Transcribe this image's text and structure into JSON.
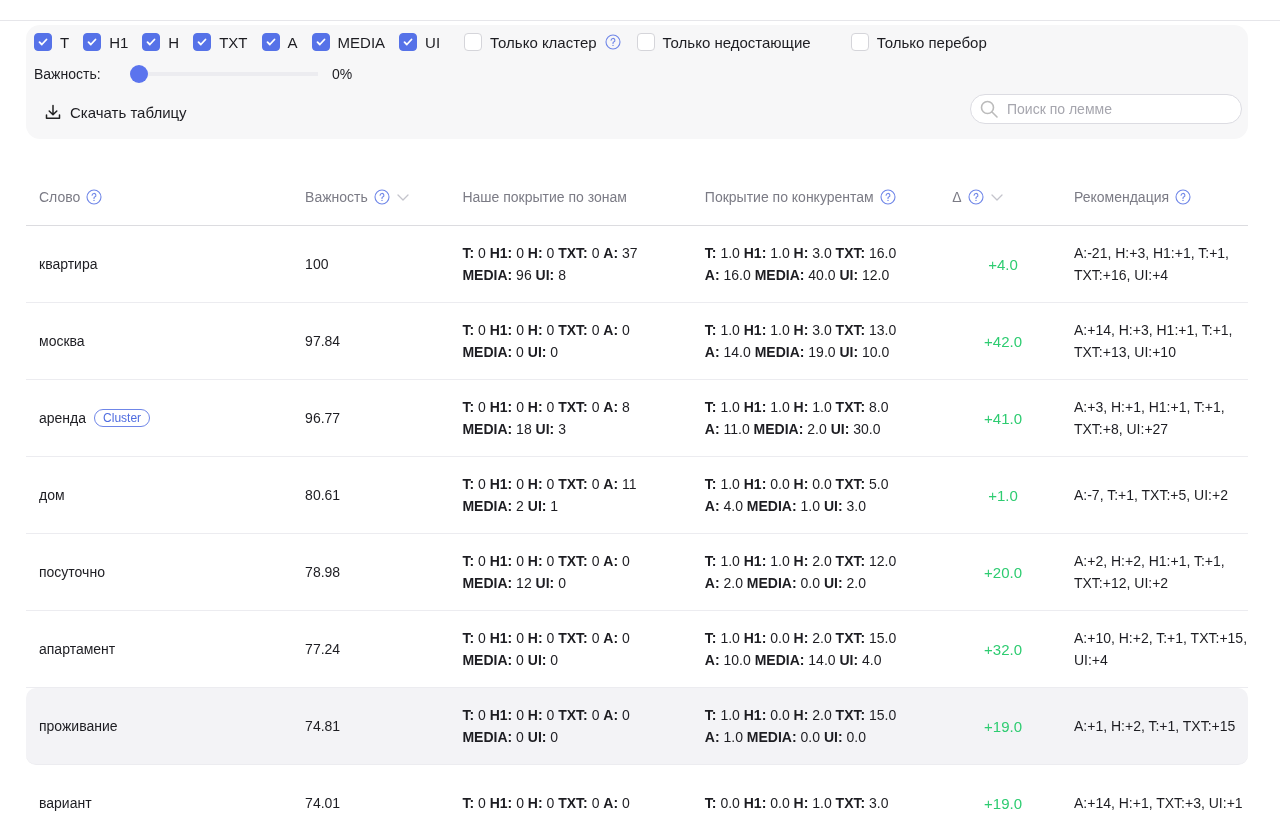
{
  "filters": [
    {
      "label": "T",
      "checked": true
    },
    {
      "label": "H1",
      "checked": true
    },
    {
      "label": "H",
      "checked": true
    },
    {
      "label": "TXT",
      "checked": true
    },
    {
      "label": "A",
      "checked": true
    },
    {
      "label": "MEDIA",
      "checked": true
    },
    {
      "label": "UI",
      "checked": true
    }
  ],
  "toggles": [
    {
      "label": "Только кластер",
      "checked": false,
      "help": true
    },
    {
      "label": "Только недостающие",
      "checked": false,
      "help": false
    },
    {
      "label": "Только перебор",
      "checked": false,
      "help": false
    }
  ],
  "importance": {
    "label": "Важность:",
    "level": 0,
    "reading": "0%"
  },
  "download": {
    "label": "Скачать таблицу"
  },
  "search": {
    "placeholder": "Поиск по лемме"
  },
  "table": {
    "columns": [
      {
        "label": "Слово",
        "help": true,
        "sortable": false
      },
      {
        "label": "Важность",
        "help": true,
        "sortable": true
      },
      {
        "label": "Наше покрытие по зонам",
        "help": false,
        "sortable": false
      },
      {
        "label": "Покрытие по конкурентам",
        "help": true,
        "sortable": false
      },
      {
        "label": "Δ",
        "help": true,
        "sortable": true
      },
      {
        "label": "Рекомендация",
        "help": true,
        "sortable": false
      }
    ],
    "rows": [
      {
        "word": "квартира",
        "tag": null,
        "importance": "100",
        "ours": [
          "**T:** 0 **H1:** 0 **H:** 0 **TXT:** 0 **A:** 37",
          "**MEDIA:** 96 **UI:** 8"
        ],
        "comp": [
          "**T:** 1.0 **H1:** 1.0 **H:** 3.0 **TXT:** 16.0",
          "**A:** 16.0 **MEDIA:** 40.0 **UI:** 12.0"
        ],
        "delta": "+4.0",
        "rec": "A:-21, H:+3, H1:+1, T:+1, TXT:+16, UI:+4",
        "selected": false
      },
      {
        "word": "москва",
        "tag": null,
        "importance": "97.84",
        "ours": [
          "**T:** 0 **H1:** 0 **H:** 0 **TXT:** 0 **A:** 0",
          "**MEDIA:** 0 **UI:** 0"
        ],
        "comp": [
          "**T:** 1.0 **H1:** 1.0 **H:** 3.0 **TXT:** 13.0",
          "**A:** 14.0 **MEDIA:** 19.0 **UI:** 10.0"
        ],
        "delta": "+42.0",
        "rec": "A:+14, H:+3, H1:+1, T:+1, TXT:+13, UI:+10",
        "selected": false
      },
      {
        "word": "аренда",
        "tag": "Cluster",
        "importance": "96.77",
        "ours": [
          "**T:** 0 **H1:** 0 **H:** 0 **TXT:** 0 **A:** 8",
          "**MEDIA:** 18 **UI:** 3"
        ],
        "comp": [
          "**T:** 1.0 **H1:** 1.0 **H:** 1.0 **TXT:** 8.0",
          "**A:** 11.0 **MEDIA:** 2.0 **UI:** 30.0"
        ],
        "delta": "+41.0",
        "rec": "A:+3, H:+1, H1:+1, T:+1, TXT:+8, UI:+27",
        "selected": false
      },
      {
        "word": "дом",
        "tag": null,
        "importance": "80.61",
        "ours": [
          "**T:** 0 **H1:** 0 **H:** 0 **TXT:** 0 **A:** 11",
          "**MEDIA:** 2 **UI:** 1"
        ],
        "comp": [
          "**T:** 1.0 **H1:** 0.0 **H:** 0.0 **TXT:** 5.0",
          "**A:** 4.0 **MEDIA:** 1.0 **UI:** 3.0"
        ],
        "delta": "+1.0",
        "rec": "A:-7, T:+1, TXT:+5, UI:+2",
        "selected": false
      },
      {
        "word": "посуточно",
        "tag": null,
        "importance": "78.98",
        "ours": [
          "**T:** 0 **H1:** 0 **H:** 0 **TXT:** 0 **A:** 0",
          "**MEDIA:** 12 **UI:** 0"
        ],
        "comp": [
          "**T:** 1.0 **H1:** 1.0 **H:** 2.0 **TXT:** 12.0",
          "**A:** 2.0 **MEDIA:** 0.0 **UI:** 2.0"
        ],
        "delta": "+20.0",
        "rec": "A:+2, H:+2, H1:+1, T:+1, TXT:+12, UI:+2",
        "selected": false
      },
      {
        "word": "апартамент",
        "tag": null,
        "importance": "77.24",
        "ours": [
          "**T:** 0 **H1:** 0 **H:** 0 **TXT:** 0 **A:** 0",
          "**MEDIA:** 0 **UI:** 0"
        ],
        "comp": [
          "**T:** 1.0 **H1:** 0.0 **H:** 2.0 **TXT:** 15.0",
          "**A:** 10.0 **MEDIA:** 14.0 **UI:** 4.0"
        ],
        "delta": "+32.0",
        "rec": "A:+10, H:+2, T:+1, TXT:+15, UI:+4",
        "selected": false
      },
      {
        "word": "проживание",
        "tag": null,
        "importance": "74.81",
        "ours": [
          "**T:** 0 **H1:** 0 **H:** 0 **TXT:** 0 **A:** 0",
          "**MEDIA:** 0 **UI:** 0"
        ],
        "comp": [
          "**T:** 1.0 **H1:** 0.0 **H:** 2.0 **TXT:** 15.0",
          "**A:** 1.0 **MEDIA:** 0.0 **UI:** 0.0"
        ],
        "delta": "+19.0",
        "rec": "A:+1, H:+2, T:+1, TXT:+15",
        "selected": true
      },
      {
        "word": "вариант",
        "tag": null,
        "importance": "74.01",
        "ours": [
          "**T:** 0 **H1:** 0 **H:** 0 **TXT:** 0 **A:** 0"
        ],
        "comp": [
          "**T:** 0.0 **H1:** 0.0 **H:** 1.0 **TXT:** 3.0"
        ],
        "delta": "+19.0",
        "rec": "A:+14, H:+1, TXT:+3, UI:+1",
        "selected": false
      }
    ]
  }
}
